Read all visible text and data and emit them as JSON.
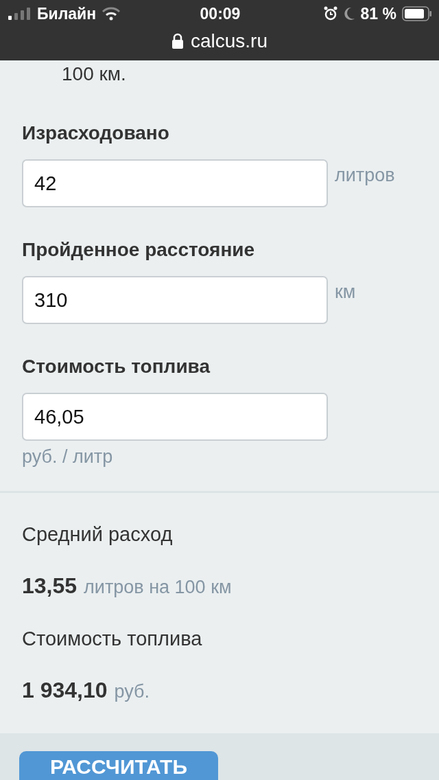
{
  "status_bar": {
    "carrier": "Билайн",
    "time": "00:09",
    "battery": "81 %"
  },
  "address_bar": {
    "url": "calcus.ru"
  },
  "intro_tail": "100 км.",
  "fields": [
    {
      "kind": "inline",
      "label": "Израсходовано",
      "value": "42",
      "unit": "литров"
    },
    {
      "kind": "inline",
      "label": "Пройденное расстояние",
      "value": "310",
      "unit": "км"
    },
    {
      "kind": "stacked",
      "label": "Стоимость топлива",
      "value": "46,05",
      "unit": "руб. / литр"
    }
  ],
  "results": [
    {
      "label": "Средний расход",
      "value": "13,55",
      "unit": "литров на 100 км"
    },
    {
      "label": "Стоимость топлива",
      "value": "1 934,10",
      "unit": "руб."
    }
  ],
  "calculate_button": "РАССЧИТАТЬ"
}
